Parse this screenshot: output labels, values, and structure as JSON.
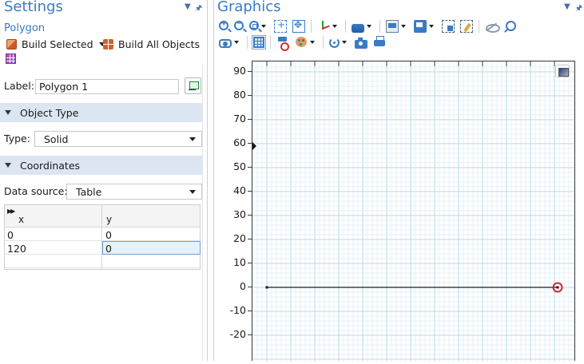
{
  "settings": {
    "title": "Settings",
    "node_name": "Polygon",
    "build_selected_label": "Build Selected",
    "build_all_label": "Build All Objects",
    "label_caption": "Label:",
    "label_value": "Polygon 1",
    "object_type_section": "Object Type",
    "type_caption": "Type:",
    "type_value": "Solid",
    "coordinates_section": "Coordinates",
    "data_source_caption": "Data source:",
    "data_source_value": "Table",
    "table": {
      "columns": [
        "x",
        "y"
      ],
      "rows": [
        {
          "x": "0",
          "y": "0"
        },
        {
          "x": "120",
          "y": "0"
        }
      ]
    }
  },
  "graphics": {
    "title": "Graphics",
    "toolbar_row1_icons": [
      "zoom-in-icon",
      "zoom-out-icon",
      "zoom-box-icon",
      "center-icon",
      "zoom-extents-icon",
      "axes-orientation-icon",
      "scene-light-icon",
      "render-mode-icon",
      "render-options-icon",
      "select-box-icon",
      "clear-selection-icon",
      "hide-icon",
      "find-icon"
    ],
    "toolbar_row2_icons": [
      "view-icon",
      "grid-icon",
      "clipping-icon",
      "color-icon",
      "reset-view-icon",
      "camera-icon",
      "print-icon"
    ],
    "y_axis_ticks": [
      "90",
      "80",
      "70",
      "60",
      "50",
      "40",
      "30",
      "20",
      "10",
      "0",
      "-10",
      "-20"
    ]
  },
  "chart_data": {
    "type": "line",
    "series": [
      {
        "x": [
          0,
          120
        ],
        "y": [
          0,
          0
        ]
      }
    ],
    "ylim": [
      -20,
      90
    ],
    "grid": true,
    "colors": {
      "line": "#1a1a1a",
      "grid_major": "#b9d7ea",
      "grid_minor": "#e6f1f8",
      "highlight_point": "#d9262c"
    }
  }
}
